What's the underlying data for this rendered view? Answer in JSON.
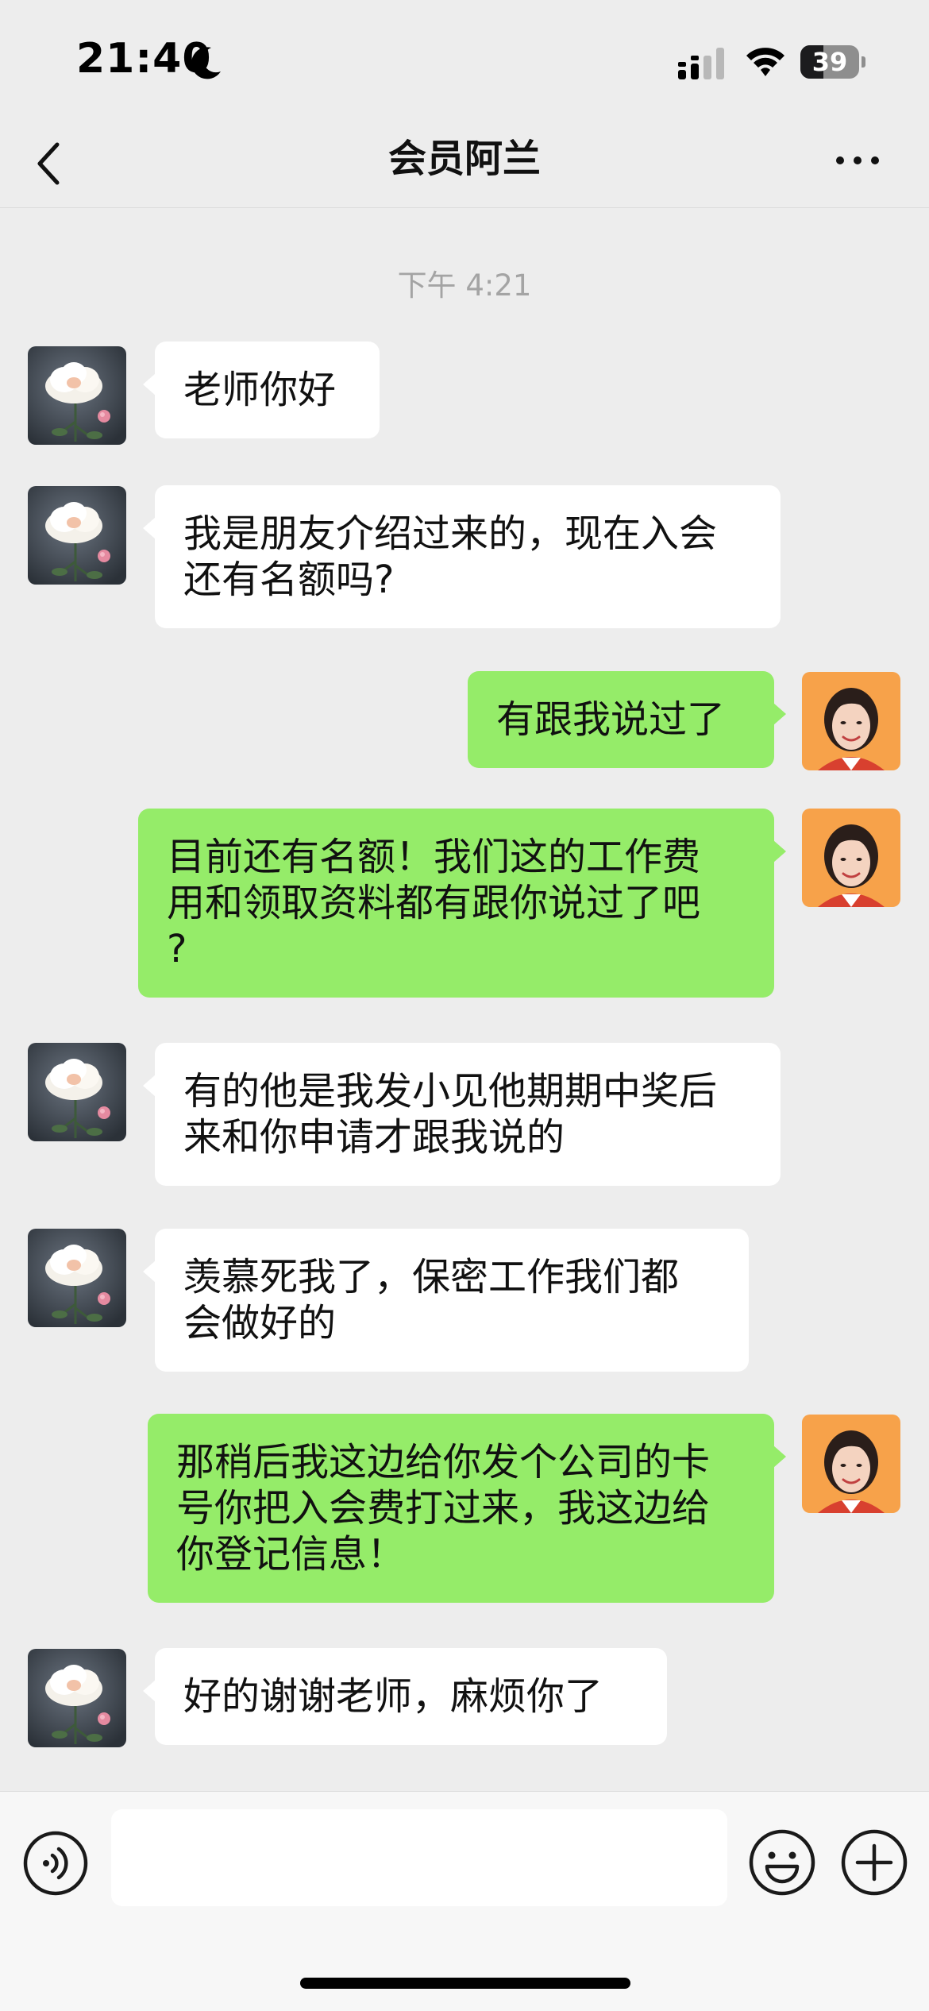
{
  "status_bar": {
    "time": "21:40",
    "battery_level": "39",
    "moon_icon": "moon-icon",
    "signal_icon": "cellular-signal-icon",
    "wifi_icon": "wifi-icon"
  },
  "nav": {
    "title": "会员阿兰",
    "back_icon": "chevron-left-icon",
    "more_icon": "more-dots-icon"
  },
  "chat": {
    "timestamp": "下午 4:21",
    "messages": [
      {
        "side": "in",
        "text": "老师你好",
        "avatar": "peony-flower-avatar"
      },
      {
        "side": "in",
        "text": "我是朋友介绍过来的，现在入会\n还有名额吗?",
        "avatar": "peony-flower-avatar"
      },
      {
        "side": "out",
        "text": "有跟我说过了",
        "avatar": "woman-portrait-avatar"
      },
      {
        "side": "out",
        "text": "目前还有名额！我们这的工作费\n用和领取资料都有跟你说过了吧\n?",
        "avatar": "woman-portrait-avatar"
      },
      {
        "side": "in",
        "text": "有的他是我发小见他期期中奖后\n来和你申请才跟我说的",
        "avatar": "peony-flower-avatar"
      },
      {
        "side": "in",
        "text": "羡慕死我了，保密工作我们都\n会做好的",
        "avatar": "peony-flower-avatar"
      },
      {
        "side": "out",
        "text": "那稍后我这边给你发个公司的卡\n号你把入会费打过来，我这边给\n你登记信息！",
        "avatar": "woman-portrait-avatar"
      },
      {
        "side": "in",
        "text": "好的谢谢老师，麻烦你了",
        "avatar": "peony-flower-avatar"
      }
    ]
  },
  "input_bar": {
    "text_value": "",
    "voice_icon": "voice-input-icon",
    "emoji_icon": "emoji-icon",
    "plus_icon": "plus-circle-icon"
  },
  "colors": {
    "background": "#ededed",
    "incoming_bubble": "#ffffff",
    "outgoing_bubble": "#95ec69",
    "timestamp": "#a4a4a4"
  }
}
